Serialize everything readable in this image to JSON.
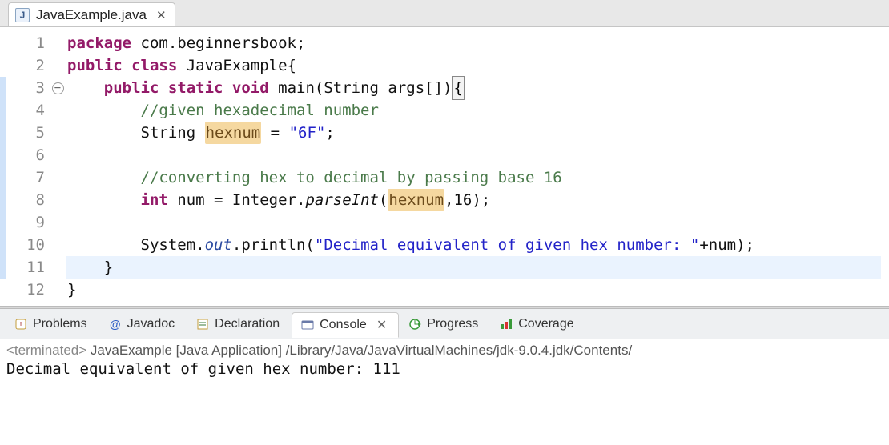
{
  "editor": {
    "tab": {
      "filename": "JavaExample.java"
    },
    "code": {
      "ln1_package": "package",
      "ln1_pkg_name": " com.beginnersbook;",
      "ln2_public": "public",
      "ln2_class": " class",
      "ln2_name": " JavaExample{",
      "ln3_indent": "    ",
      "ln3_public": "public",
      "ln3_static": " static",
      "ln3_void": " void",
      "ln3_main": " main(String args[])",
      "ln3_brace": "{",
      "ln4": "        //given hexadecimal number",
      "ln5a": "        String ",
      "ln5_hex": "hexnum",
      "ln5b": " = ",
      "ln5_str": "\"6F\"",
      "ln5c": ";",
      "ln7": "        //converting hex to decimal by passing base 16 ",
      "ln8a": "        ",
      "ln8_int": "int",
      "ln8b": " num = Integer.",
      "ln8_parse": "parseInt",
      "ln8c": "(",
      "ln8_hex": "hexnum",
      "ln8d": ",16);",
      "ln10a": "        System.",
      "ln10_out": "out",
      "ln10b": ".println(",
      "ln10_str": "\"Decimal equivalent of given hex number: \"",
      "ln10c": "+num);",
      "ln11": "    }",
      "ln12": "}"
    },
    "line_numbers": [
      "1",
      "2",
      "3",
      "4",
      "5",
      "6",
      "7",
      "8",
      "9",
      "10",
      "11",
      "12"
    ]
  },
  "bottomTabs": {
    "problems": "Problems",
    "javadoc": "Javadoc",
    "declaration": "Declaration",
    "console": "Console",
    "progress": "Progress",
    "coverage": "Coverage"
  },
  "console": {
    "status_prefix": "<terminated>",
    "status_body": " JavaExample [Java Application] /Library/Java/JavaVirtualMachines/jdk-9.0.4.jdk/Contents/",
    "output": "Decimal equivalent of given hex number: 111"
  }
}
